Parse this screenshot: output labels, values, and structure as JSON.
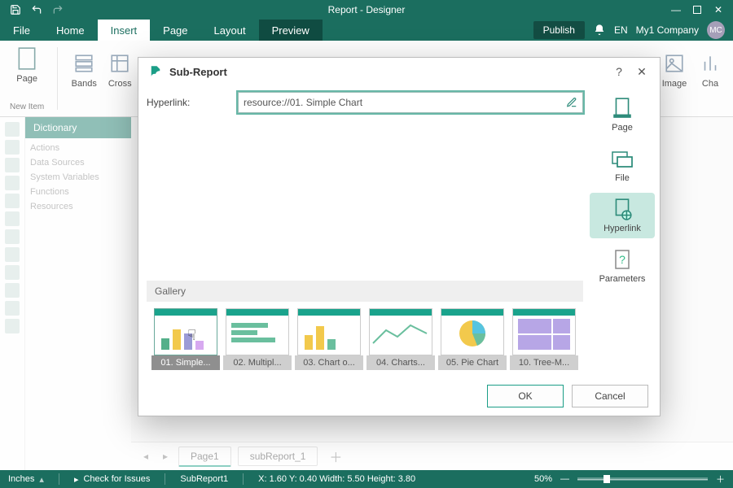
{
  "window": {
    "title": "Report - Designer"
  },
  "menu": {
    "file": "File",
    "home": "Home",
    "insert": "Insert",
    "page": "Page",
    "layout": "Layout",
    "preview": "Preview",
    "publish": "Publish",
    "lang": "EN",
    "company": "My1 Company",
    "avatar": "MC"
  },
  "ribbon": {
    "page": "Page",
    "bands": "Bands",
    "cross": "Cross",
    "image": "Image",
    "chart": "Cha",
    "newitem": "New Item"
  },
  "dict": {
    "title": "Dictionary",
    "actions": "Actions",
    "ds": "Data Sources",
    "sv": "System Variables",
    "fn": "Functions",
    "res": "Resources"
  },
  "dialog": {
    "title": "Sub-Report",
    "hyperlink_label": "Hyperlink:",
    "hyperlink_value": "resource://01. Simple Chart",
    "side": {
      "page": "Page",
      "file": "File",
      "hyperlink": "Hyperlink",
      "parameters": "Parameters"
    },
    "gallery_label": "Gallery",
    "gallery": [
      "01. Simple...",
      "02. Multipl...",
      "03. Chart o...",
      "04. Charts...",
      "05. Pie Chart",
      "10. Tree-M..."
    ],
    "ok": "OK",
    "cancel": "Cancel"
  },
  "pagetabs": {
    "page1": "Page1",
    "sub": "subReport_1"
  },
  "status": {
    "units": "Inches",
    "check": "Check for Issues",
    "obj": "SubReport1",
    "coords": "X: 1.60  Y: 0.40  Width: 5.50  Height: 3.80",
    "zoom": "50%"
  }
}
